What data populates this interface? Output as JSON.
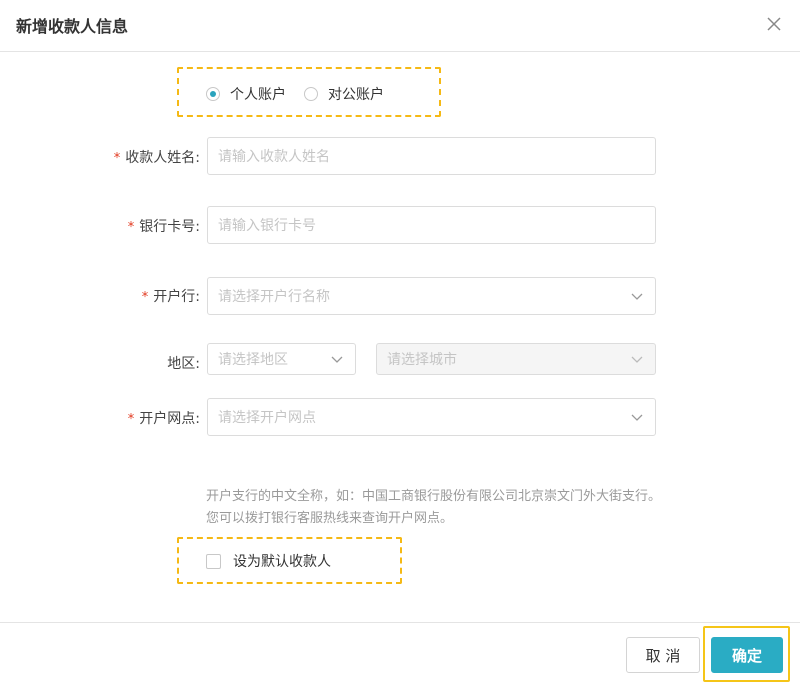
{
  "dialog": {
    "title": "新增收款人信息",
    "close_icon": "close-icon"
  },
  "account_type": {
    "options": [
      {
        "label": "个人账户",
        "checked": true
      },
      {
        "label": "对公账户",
        "checked": false
      }
    ]
  },
  "form": {
    "payee_name": {
      "label": "收款人姓名:",
      "required": true,
      "placeholder": "请输入收款人姓名"
    },
    "card_number": {
      "label": "银行卡号:",
      "required": true,
      "placeholder": "请输入银行卡号"
    },
    "bank": {
      "label": "开户行:",
      "required": true,
      "placeholder": "请选择开户行名称"
    },
    "region": {
      "label": "地区:",
      "required": false,
      "province_placeholder": "请选择地区",
      "city_placeholder": "请选择城市"
    },
    "branch": {
      "label": "开户网点:",
      "required": true,
      "placeholder": "请选择开户网点"
    },
    "required_mark": "*"
  },
  "hint": "开户支行的中文全称，如：中国工商银行股份有限公司北京崇文门外大街支行。 您可以拨打银行客服热线来查询开户网点。",
  "default_payee": {
    "label": "设为默认收款人",
    "checked": false
  },
  "footer": {
    "cancel_label": "取 消",
    "confirm_label": "确定"
  },
  "colors": {
    "accent": "#2aacc4",
    "highlight": "#f5b915",
    "required": "#e2391f"
  }
}
